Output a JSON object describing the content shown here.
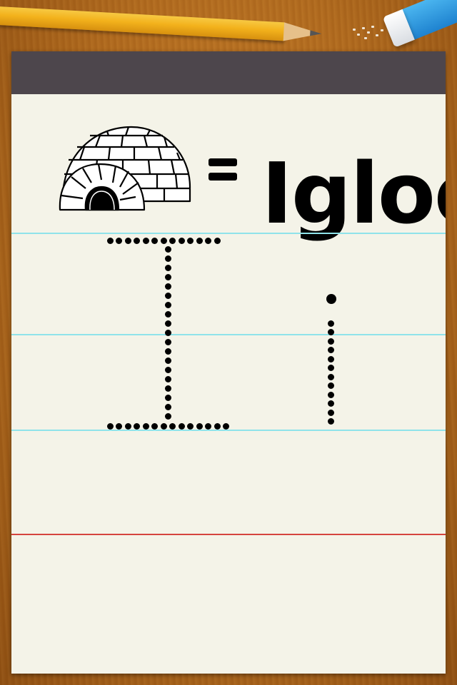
{
  "lesson": {
    "word": "Igloo",
    "equals_symbol": "=",
    "image": "igloo-icon",
    "trace_uppercase": "I",
    "trace_lowercase": "i"
  },
  "colors": {
    "header": "#4d464c",
    "paper": "#f4f3e8",
    "guide_line": "#8fe3ea",
    "baseline_red": "#d5443e",
    "pencil": "#f3b21c",
    "eraser": "#1e82cf"
  }
}
